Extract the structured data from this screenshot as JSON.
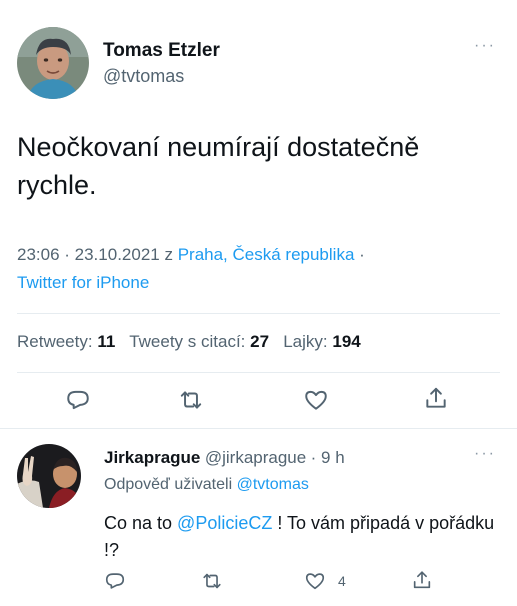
{
  "tweet": {
    "author_name": "Tomas Etzler",
    "author_handle": "@tvtomas",
    "more_label": "···",
    "text": "Neočkovaní neumírají dostatečně rychle.",
    "time": "23:06 · 23.10.2021 z ",
    "location": "Praha, Česká republika",
    "separator": " ·",
    "source": "Twitter for iPhone",
    "stats": {
      "retweets_label": "Retweety:",
      "retweets": "11",
      "quotes_label": "Tweety s citací:",
      "quotes": "27",
      "likes_label": "Lajky:",
      "likes": "194"
    }
  },
  "reply": {
    "author_name": "Jirkaprague",
    "author_handle": "@jirkaprague",
    "time": "· 9 h",
    "more_label": "···",
    "replying_to_label": "Odpověď uživateli",
    "replying_to_handle": "@tvtomas",
    "text_before": "Co na to ",
    "mention": "@PolicieCZ",
    "text_after": " ! To vám připadá v pořádku !?",
    "like_count": "4"
  },
  "colors": {
    "accent": "#1d9bf0",
    "text": "#0f1419",
    "muted": "#536471"
  },
  "icons": [
    "reply-icon",
    "retweet-icon",
    "like-icon",
    "share-icon"
  ]
}
